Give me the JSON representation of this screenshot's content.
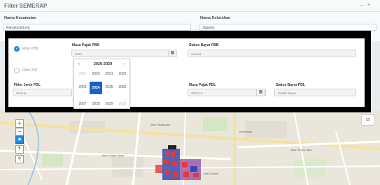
{
  "header": {
    "title": "Filter SEMERAP",
    "icons": [
      "minimize-icon",
      "close-icon"
    ]
  },
  "filter": {
    "kecamatan_label": "Nama Kecamatan",
    "kecamatan_value": "Rangkasbitung",
    "kelurahan_label": "Nama Kelurahan",
    "kelurahan_value": "Jagalan"
  },
  "panel": {
    "pbb_label": "Filter PBB",
    "pbb_checked": true,
    "masa_pajak_pbb_label": "Masa Pajak PBB",
    "masa_pajak_pbb_value": "2024",
    "status_bayar_pbb_label": "Status Bayar PBB",
    "status_bayar_pbb_value": "Semua",
    "znt_label": "Filter ZNT",
    "znt_checked": false,
    "jenis_pdl_label": "Filter Jenis PDL",
    "jenis_pdl_value": "Semua",
    "masa_pajak_pdl_label": "Masa Pajak PDL",
    "masa_pajak_pdl_value": "2024-10",
    "status_bayar_pdl_label": "Status Bayar PDL",
    "status_bayar_pdl_value": "Sudah Bayar"
  },
  "year_picker": {
    "range_title": "2020-2029",
    "prev": "‹",
    "next": "›",
    "years": [
      {
        "label": "2019",
        "state": "faded"
      },
      {
        "label": "2020",
        "state": "normal"
      },
      {
        "label": "2021",
        "state": "normal"
      },
      {
        "label": "2022",
        "state": "normal"
      },
      {
        "label": "2023",
        "state": "normal"
      },
      {
        "label": "2024",
        "state": "selected"
      },
      {
        "label": "2025",
        "state": "normal"
      },
      {
        "label": "2026",
        "state": "normal"
      },
      {
        "label": "2027",
        "state": "normal"
      },
      {
        "label": "2028",
        "state": "normal"
      },
      {
        "label": "2029",
        "state": "normal"
      },
      {
        "label": "2030",
        "state": "faded"
      }
    ]
  },
  "map": {
    "controls": [
      "zoom-in",
      "zoom-out",
      "locate",
      "pin",
      "search"
    ],
    "zoom_in": "+",
    "zoom_out": "−",
    "streets": [
      "Jalan Empu Nala",
      "Jalan Empu Nala",
      "Jalan Majapahit",
      "Kelurahan",
      "Jalan Gajah Mada",
      "Jalan Kartini"
    ],
    "layers_icon": "layers-icon",
    "colors": {
      "parcel_red": "#e53935",
      "parcel_blue": "#3949ab",
      "road": "#ffffff",
      "road_major": "#f6e9a8",
      "accent": "#1e88e5"
    }
  }
}
